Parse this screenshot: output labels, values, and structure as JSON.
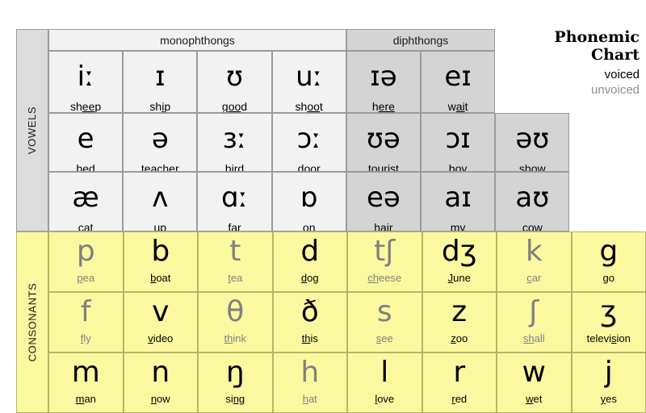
{
  "title": {
    "line1": "Phonemic",
    "line2": "Chart"
  },
  "legend": {
    "voiced": "voiced",
    "unvoiced": "unvoiced",
    "voiced_color": "#000000",
    "unvoiced_color": "#8f8f8f"
  },
  "sections": {
    "vowels_label": "VOWELS",
    "consonants_label": "CONSONANTS",
    "vowels_bg": "#f2f2f2",
    "diphthongs_bg": "#d4d4d4",
    "consonants_bg": "#faf9a0"
  },
  "group_headers": {
    "monophthongs": "monophthongs",
    "diphthongs": "diphthongs"
  },
  "vowels": {
    "row1": [
      {
        "symbol": "iː",
        "word_pre": "sh",
        "word_u": "ee",
        "word_post": "p",
        "voicing": "voiced"
      },
      {
        "symbol": "ɪ",
        "word_pre": "sh",
        "word_u": "i",
        "word_post": "p",
        "voicing": "voiced"
      },
      {
        "symbol": "ʊ",
        "word_pre": "g",
        "word_u": "oo",
        "word_post": "d",
        "voicing": "voiced"
      },
      {
        "symbol": "uː",
        "word_pre": "sh",
        "word_u": "oo",
        "word_post": "t",
        "voicing": "voiced"
      },
      {
        "symbol": "ɪə",
        "word_pre": "h",
        "word_u": "ere",
        "word_post": "",
        "voicing": "voiced"
      },
      {
        "symbol": "eɪ",
        "word_pre": "w",
        "word_u": "ai",
        "word_post": "t",
        "voicing": "voiced"
      }
    ],
    "row2": [
      {
        "symbol": "e",
        "word_pre": "b",
        "word_u": "e",
        "word_post": "d",
        "voicing": "voiced"
      },
      {
        "symbol": "ə",
        "word_pre": "teach",
        "word_u": "e",
        "word_post": "r",
        "voicing": "voiced"
      },
      {
        "symbol": "ɜː",
        "word_pre": "b",
        "word_u": "ir",
        "word_post": "d",
        "voicing": "voiced"
      },
      {
        "symbol": "ɔː",
        "word_pre": "d",
        "word_u": "oo",
        "word_post": "r",
        "voicing": "voiced"
      },
      {
        "symbol": "ʊə",
        "word_pre": "t",
        "word_u": "ou",
        "word_post": "rist",
        "voicing": "voiced"
      },
      {
        "symbol": "ɔɪ",
        "word_pre": "b",
        "word_u": "oy",
        "word_post": "",
        "voicing": "voiced"
      },
      {
        "symbol": "əʊ",
        "word_pre": "sh",
        "word_u": "ow",
        "word_post": "",
        "voicing": "voiced"
      }
    ],
    "row3": [
      {
        "symbol": "æ",
        "word_pre": "c",
        "word_u": "a",
        "word_post": "t",
        "voicing": "voiced"
      },
      {
        "symbol": "ʌ",
        "word_pre": "",
        "word_u": "u",
        "word_post": "p",
        "voicing": "voiced"
      },
      {
        "symbol": "ɑː",
        "word_pre": "f",
        "word_u": "ar",
        "word_post": "",
        "voicing": "voiced"
      },
      {
        "symbol": "ɒ",
        "word_pre": "",
        "word_u": "o",
        "word_post": "n",
        "voicing": "voiced"
      },
      {
        "symbol": "eə",
        "word_pre": "h",
        "word_u": "ai",
        "word_post": "r",
        "voicing": "voiced"
      },
      {
        "symbol": "aɪ",
        "word_pre": "m",
        "word_u": "y",
        "word_post": "",
        "voicing": "voiced"
      },
      {
        "symbol": "aʊ",
        "word_pre": "c",
        "word_u": "ow",
        "word_post": "",
        "voicing": "voiced"
      }
    ]
  },
  "consonants": {
    "row1": [
      {
        "symbol": "p",
        "word_pre": "",
        "word_u": "p",
        "word_post": "ea",
        "voicing": "unvoiced"
      },
      {
        "symbol": "b",
        "word_pre": "",
        "word_u": "b",
        "word_post": "oat",
        "voicing": "voiced"
      },
      {
        "symbol": "t",
        "word_pre": "",
        "word_u": "t",
        "word_post": "ea",
        "voicing": "unvoiced"
      },
      {
        "symbol": "d",
        "word_pre": "",
        "word_u": "d",
        "word_post": "og",
        "voicing": "voiced"
      },
      {
        "symbol": "tʃ",
        "word_pre": "",
        "word_u": "ch",
        "word_post": "eese",
        "voicing": "unvoiced"
      },
      {
        "symbol": "dʒ",
        "word_pre": "",
        "word_u": "J",
        "word_post": "une",
        "voicing": "voiced"
      },
      {
        "symbol": "k",
        "word_pre": "",
        "word_u": "c",
        "word_post": "ar",
        "voicing": "unvoiced"
      },
      {
        "symbol": "g",
        "word_pre": "",
        "word_u": "g",
        "word_post": "o",
        "voicing": "voiced"
      }
    ],
    "row2": [
      {
        "symbol": "f",
        "word_pre": "",
        "word_u": "f",
        "word_post": "ly",
        "voicing": "unvoiced"
      },
      {
        "symbol": "v",
        "word_pre": "",
        "word_u": "v",
        "word_post": "ideo",
        "voicing": "voiced"
      },
      {
        "symbol": "θ",
        "word_pre": "",
        "word_u": "th",
        "word_post": "ink",
        "voicing": "unvoiced"
      },
      {
        "symbol": "ð",
        "word_pre": "",
        "word_u": "th",
        "word_post": "is",
        "voicing": "voiced"
      },
      {
        "symbol": "s",
        "word_pre": "",
        "word_u": "s",
        "word_post": "ee",
        "voicing": "unvoiced"
      },
      {
        "symbol": "z",
        "word_pre": "",
        "word_u": "z",
        "word_post": "oo",
        "voicing": "voiced"
      },
      {
        "symbol": "ʃ",
        "word_pre": "",
        "word_u": "sh",
        "word_post": "all",
        "voicing": "unvoiced"
      },
      {
        "symbol": "ʒ",
        "word_pre": "televi",
        "word_u": "s",
        "word_post": "ion",
        "voicing": "voiced"
      }
    ],
    "row3": [
      {
        "symbol": "m",
        "word_pre": "",
        "word_u": "m",
        "word_post": "an",
        "voicing": "voiced"
      },
      {
        "symbol": "n",
        "word_pre": "",
        "word_u": "n",
        "word_post": "ow",
        "voicing": "voiced"
      },
      {
        "symbol": "ŋ",
        "word_pre": "si",
        "word_u": "ng",
        "word_post": "",
        "voicing": "voiced"
      },
      {
        "symbol": "h",
        "word_pre": "",
        "word_u": "h",
        "word_post": "at",
        "voicing": "unvoiced"
      },
      {
        "symbol": "l",
        "word_pre": "",
        "word_u": "l",
        "word_post": "ove",
        "voicing": "voiced"
      },
      {
        "symbol": "r",
        "word_pre": "",
        "word_u": "r",
        "word_post": "ed",
        "voicing": "voiced"
      },
      {
        "symbol": "w",
        "word_pre": "",
        "word_u": "w",
        "word_post": "et",
        "voicing": "voiced"
      },
      {
        "symbol": "j",
        "word_pre": "",
        "word_u": "y",
        "word_post": "es",
        "voicing": "voiced"
      }
    ]
  }
}
